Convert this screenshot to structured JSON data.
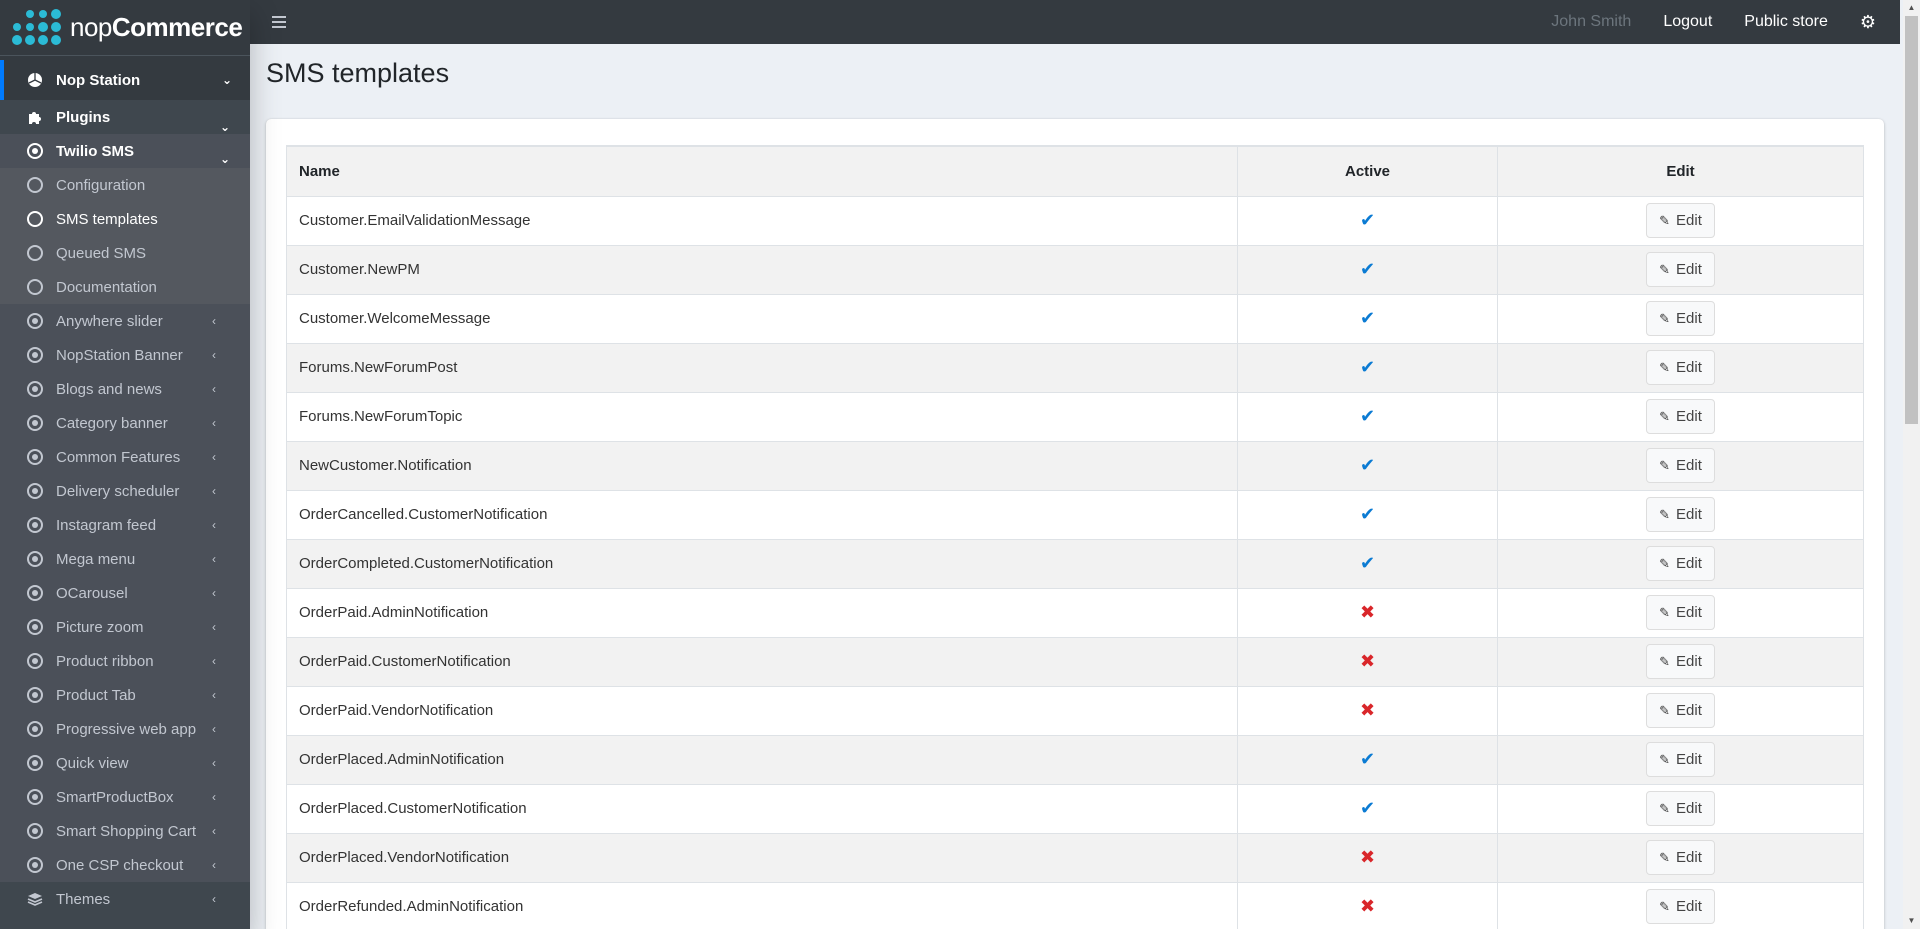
{
  "brand": {
    "prefix": "nop",
    "name": "Commerce"
  },
  "header": {
    "user": "John Smith",
    "logout": "Logout",
    "public_store": "Public store"
  },
  "sidebar": {
    "top": {
      "label": "Nop Station",
      "icon": "nopstation-icon"
    },
    "plugins": {
      "label": "Plugins",
      "icon": "puzzle-icon"
    },
    "twilio": {
      "label": "Twilio SMS",
      "icon": "dot-circle-icon"
    },
    "twilio_children": [
      {
        "label": "Configuration",
        "active": false
      },
      {
        "label": "SMS templates",
        "active": true
      },
      {
        "label": "Queued SMS",
        "active": false
      },
      {
        "label": "Documentation",
        "active": false
      }
    ],
    "plugin_items": [
      {
        "label": "Anywhere slider"
      },
      {
        "label": "NopStation Banner"
      },
      {
        "label": "Blogs and news"
      },
      {
        "label": "Category banner"
      },
      {
        "label": "Common Features"
      },
      {
        "label": "Delivery scheduler"
      },
      {
        "label": "Instagram feed"
      },
      {
        "label": "Mega menu"
      },
      {
        "label": "OCarousel"
      },
      {
        "label": "Picture zoom"
      },
      {
        "label": "Product ribbon"
      },
      {
        "label": "Product Tab"
      },
      {
        "label": "Progressive web app"
      },
      {
        "label": "Quick view"
      },
      {
        "label": "SmartProductBox"
      },
      {
        "label": "Smart Shopping Cart"
      },
      {
        "label": "One CSP checkout"
      }
    ],
    "themes": {
      "label": "Themes",
      "icon": "layers-icon"
    }
  },
  "page": {
    "title": "SMS templates"
  },
  "table": {
    "columns": {
      "name": "Name",
      "active": "Active",
      "edit": "Edit"
    },
    "edit_label": "Edit",
    "rows": [
      {
        "name": "Customer.EmailValidationMessage",
        "active": true
      },
      {
        "name": "Customer.NewPM",
        "active": true
      },
      {
        "name": "Customer.WelcomeMessage",
        "active": true
      },
      {
        "name": "Forums.NewForumPost",
        "active": true
      },
      {
        "name": "Forums.NewForumTopic",
        "active": true
      },
      {
        "name": "NewCustomer.Notification",
        "active": true
      },
      {
        "name": "OrderCancelled.CustomerNotification",
        "active": true
      },
      {
        "name": "OrderCompleted.CustomerNotification",
        "active": true
      },
      {
        "name": "OrderPaid.AdminNotification",
        "active": false
      },
      {
        "name": "OrderPaid.CustomerNotification",
        "active": false
      },
      {
        "name": "OrderPaid.VendorNotification",
        "active": false
      },
      {
        "name": "OrderPlaced.AdminNotification",
        "active": true
      },
      {
        "name": "OrderPlaced.CustomerNotification",
        "active": true
      },
      {
        "name": "OrderPlaced.VendorNotification",
        "active": false
      },
      {
        "name": "OrderRefunded.AdminNotification",
        "active": false
      }
    ]
  },
  "colors": {
    "sidebar_bg": "#343a40",
    "accent": "#007bff",
    "logo": "#2bbbd6",
    "check": "#0b7bd3",
    "cross": "#d9262a"
  }
}
